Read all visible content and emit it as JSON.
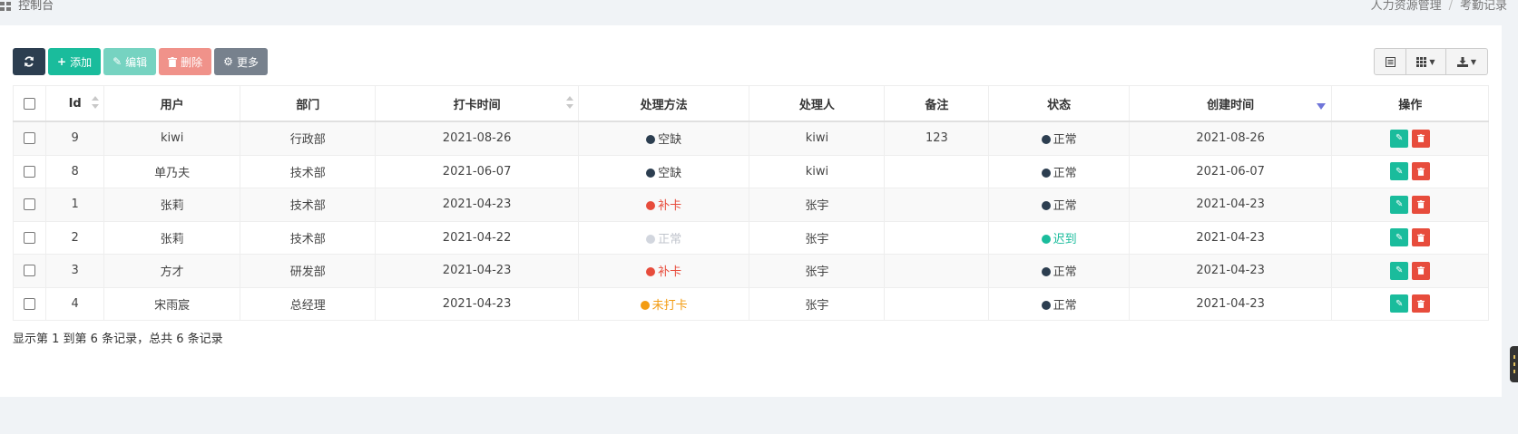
{
  "breadcrumb": {
    "left": "控制台",
    "right": [
      "人力资源管理",
      "考勤记录"
    ]
  },
  "toolbar": {
    "add_label": "添加",
    "edit_label": "编辑",
    "delete_label": "删除",
    "more_label": "更多"
  },
  "table": {
    "columns": [
      "Id",
      "用户",
      "部门",
      "打卡时间",
      "处理方法",
      "处理人",
      "备注",
      "状态",
      "创建时间",
      "操作"
    ],
    "rows": [
      {
        "id": "9",
        "user": "kiwi",
        "dept": "行政部",
        "time": "2021-08-26",
        "method": "空缺",
        "method_color": "#2c3e50",
        "handler": "kiwi",
        "note": "123",
        "status": "正常",
        "status_color": "#2c3e50",
        "created": "2021-08-26"
      },
      {
        "id": "8",
        "user": "单乃夫",
        "dept": "技术部",
        "time": "2021-06-07",
        "method": "空缺",
        "method_color": "#2c3e50",
        "handler": "kiwi",
        "note": "",
        "status": "正常",
        "status_color": "#2c3e50",
        "created": "2021-06-07"
      },
      {
        "id": "1",
        "user": "张莉",
        "dept": "技术部",
        "time": "2021-04-23",
        "method": "补卡",
        "method_color": "#e74c3c",
        "handler": "张宇",
        "note": "",
        "status": "正常",
        "status_color": "#2c3e50",
        "created": "2021-04-23"
      },
      {
        "id": "2",
        "user": "张莉",
        "dept": "技术部",
        "time": "2021-04-22",
        "method": "正常",
        "method_color": "#d2d6de",
        "handler": "张宇",
        "note": "",
        "status": "迟到",
        "status_color": "#1abc9c",
        "created": "2021-04-23"
      },
      {
        "id": "3",
        "user": "方才",
        "dept": "研发部",
        "time": "2021-04-23",
        "method": "补卡",
        "method_color": "#e74c3c",
        "handler": "张宇",
        "note": "",
        "status": "正常",
        "status_color": "#2c3e50",
        "created": "2021-04-23"
      },
      {
        "id": "4",
        "user": "宋雨宸",
        "dept": "总经理",
        "time": "2021-04-23",
        "method": "未打卡",
        "method_color": "#f39c12",
        "handler": "张宇",
        "note": "",
        "status": "正常",
        "status_color": "#2c3e50",
        "created": "2021-04-23"
      }
    ]
  },
  "pagination": {
    "summary": "显示第 1 到第 6 条记录，总共 6 条记录"
  }
}
